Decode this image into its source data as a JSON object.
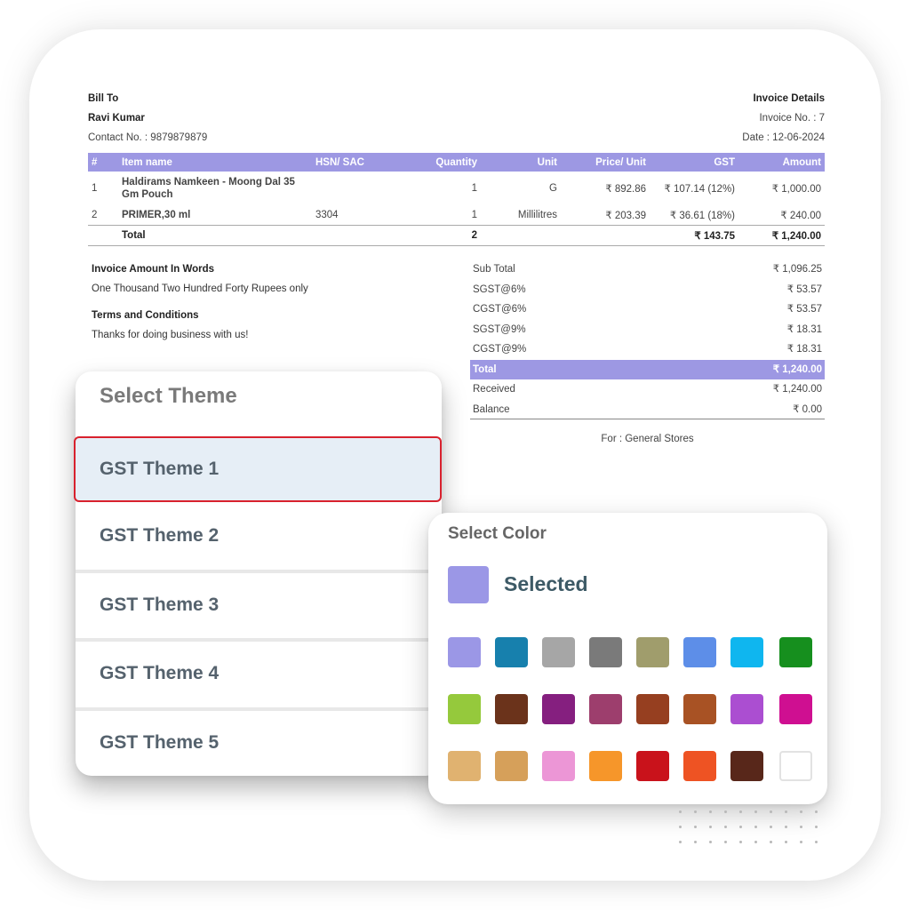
{
  "invoice": {
    "bill_to_label": "Bill To",
    "customer_name": "Ravi Kumar",
    "contact": "Contact No. : 9879879879",
    "details_label": "Invoice Details",
    "invoice_no": "Invoice No. : 7",
    "date": "Date : 12-06-2024",
    "header_color": "#9d98e3",
    "columns": [
      "#",
      "Item name",
      "HSN/ SAC",
      "Quantity",
      "Unit",
      "Price/ Unit",
      "GST",
      "Amount"
    ],
    "rows": [
      {
        "no": "1",
        "name": "Haldirams Namkeen - Moong Dal 35 Gm Pouch",
        "hsn": "",
        "qty": "1",
        "unit": "G",
        "price": "₹ 892.86",
        "gst": "₹ 107.14 (12%)",
        "amount": "₹ 1,000.00"
      },
      {
        "no": "2",
        "name": "PRIMER,30 ml",
        "hsn": "3304",
        "qty": "1",
        "unit": "Millilitres",
        "price": "₹ 203.39",
        "gst": "₹ 36.61 (18%)",
        "amount": "₹ 240.00"
      }
    ],
    "total_row": {
      "label": "Total",
      "qty": "2",
      "gst": "₹ 143.75",
      "amount": "₹ 1,240.00"
    },
    "amount_words_label": "Invoice Amount In Words",
    "amount_words": "One Thousand Two Hundred Forty Rupees only",
    "terms_label": "Terms and Conditions",
    "terms": "Thanks for doing business with us!",
    "summary": [
      {
        "label": "Sub Total",
        "value": "₹ 1,096.25"
      },
      {
        "label": "SGST@6%",
        "value": "₹ 53.57"
      },
      {
        "label": "CGST@6%",
        "value": "₹ 53.57"
      },
      {
        "label": "SGST@9%",
        "value": "₹ 18.31"
      },
      {
        "label": "CGST@9%",
        "value": "₹ 18.31"
      },
      {
        "label": "Total",
        "value": "₹ 1,240.00"
      },
      {
        "label": "Received",
        "value": "₹ 1,240.00"
      },
      {
        "label": "Balance",
        "value": "₹ 0.00"
      }
    ],
    "for_line": "For : General Stores"
  },
  "theme_panel": {
    "title": "Select Theme",
    "items": [
      "GST Theme 1",
      "GST Theme 2",
      "GST Theme 3",
      "GST Theme 4",
      "GST Theme 5"
    ],
    "selected_index": 0
  },
  "color_panel": {
    "title": "Select Color",
    "selected_label": "Selected",
    "selected_color": "#9b97e6",
    "swatches": [
      "#9b97e6",
      "#1780ad",
      "#a6a6a6",
      "#7a7a7a",
      "#a09d6c",
      "#5d8ee8",
      "#0fb6ef",
      "#168f1e",
      "#95c93c",
      "#6b331b",
      "#851f7f",
      "#9d3e6d",
      "#963f20",
      "#a85224",
      "#ab4ed1",
      "#cf0f91",
      "#e0b270",
      "#d6a05a",
      "#ec96d6",
      "#f6962a",
      "#c9121b",
      "#ee5323",
      "#58271a",
      "#ffffff"
    ]
  }
}
